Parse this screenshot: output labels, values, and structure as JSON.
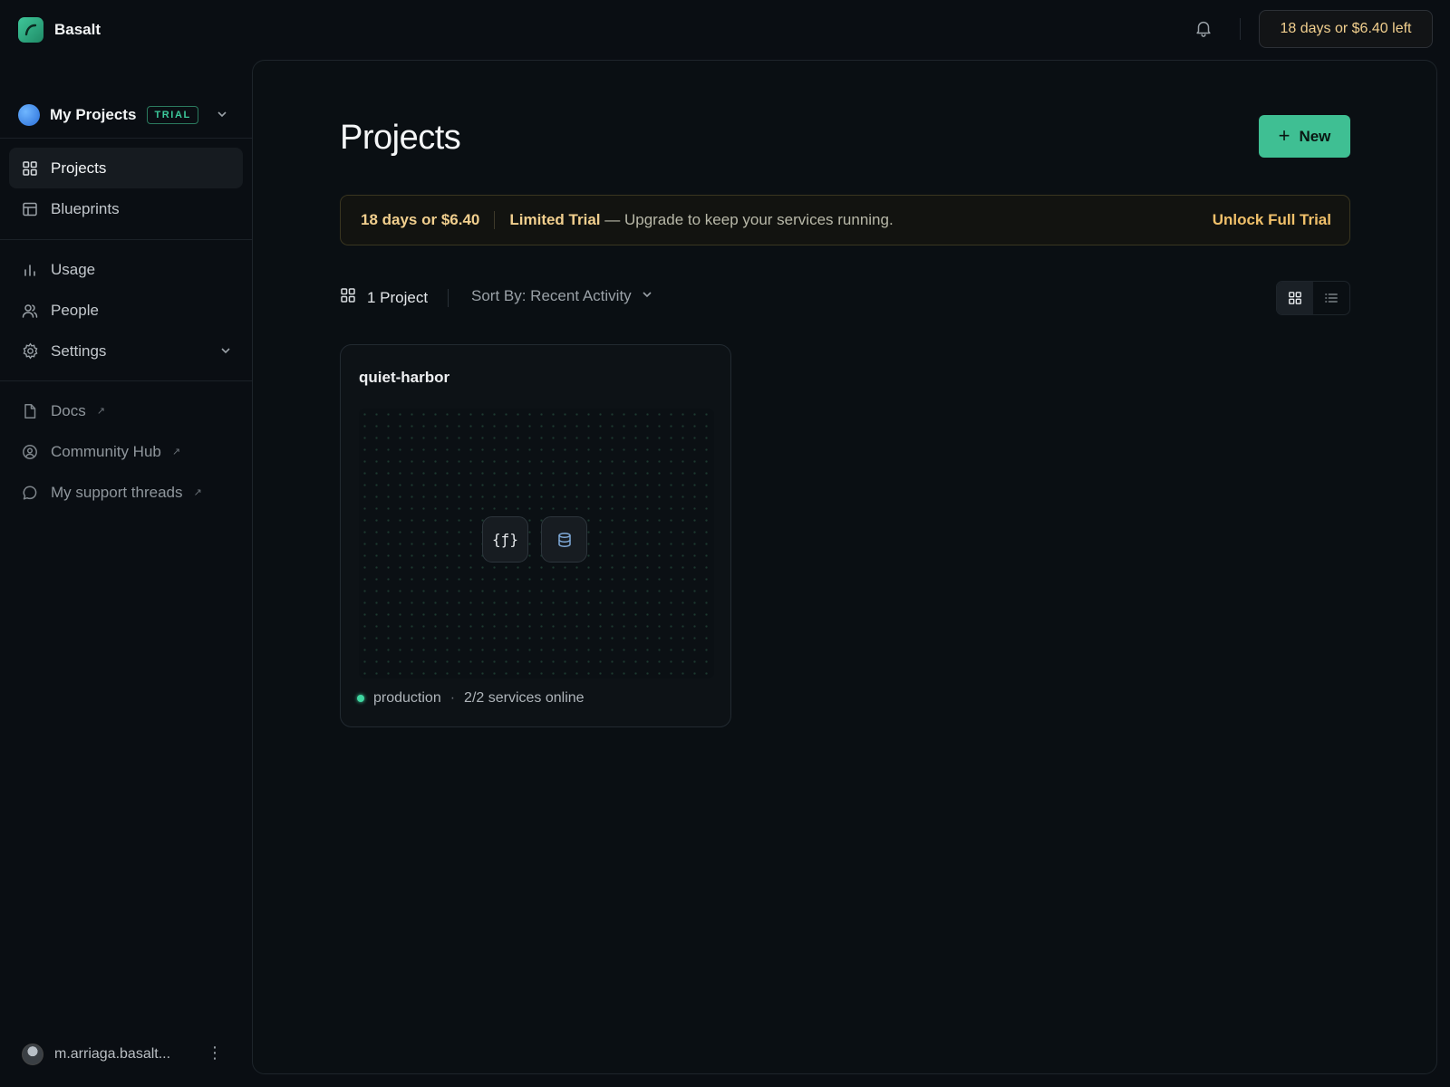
{
  "app": {
    "name": "Basalt"
  },
  "topbar": {
    "trial_pill": "18 days or $6.40 left"
  },
  "workspace": {
    "name": "My Projects",
    "badge": "TRIAL"
  },
  "sidebar": {
    "primary": [
      {
        "label": "Projects",
        "icon": "grid-icon",
        "active": true
      },
      {
        "label": "Blueprints",
        "icon": "layout-icon",
        "active": false
      }
    ],
    "secondary": [
      {
        "label": "Usage",
        "icon": "bar-chart-icon"
      },
      {
        "label": "People",
        "icon": "users-icon"
      },
      {
        "label": "Settings",
        "icon": "gear-icon"
      }
    ],
    "links": [
      {
        "label": "Docs",
        "icon": "document-icon"
      },
      {
        "label": "Community Hub",
        "icon": "community-icon"
      },
      {
        "label": "My support threads",
        "icon": "chat-bubble-icon"
      }
    ],
    "user": {
      "email": "m.arriaga.basalt..."
    }
  },
  "main": {
    "title": "Projects",
    "new_button": "New",
    "banner": {
      "amount": "18 days or $6.40",
      "bold": "Limited Trial",
      "message": " — Upgrade to keep your services running.",
      "action": "Unlock Full Trial"
    },
    "toolbar": {
      "count": "1 Project",
      "sort": "Sort By: Recent Activity"
    },
    "projects": [
      {
        "name": "quiet-harbor",
        "services": [
          "function-icon",
          "database-icon"
        ],
        "function_glyph": "{ƒ}",
        "environment": "production",
        "status": "2/2 services online"
      }
    ]
  },
  "colors": {
    "accent": "#3fbf93",
    "trial_text": "#f1cf8e",
    "status_online": "#3fd6a0"
  }
}
